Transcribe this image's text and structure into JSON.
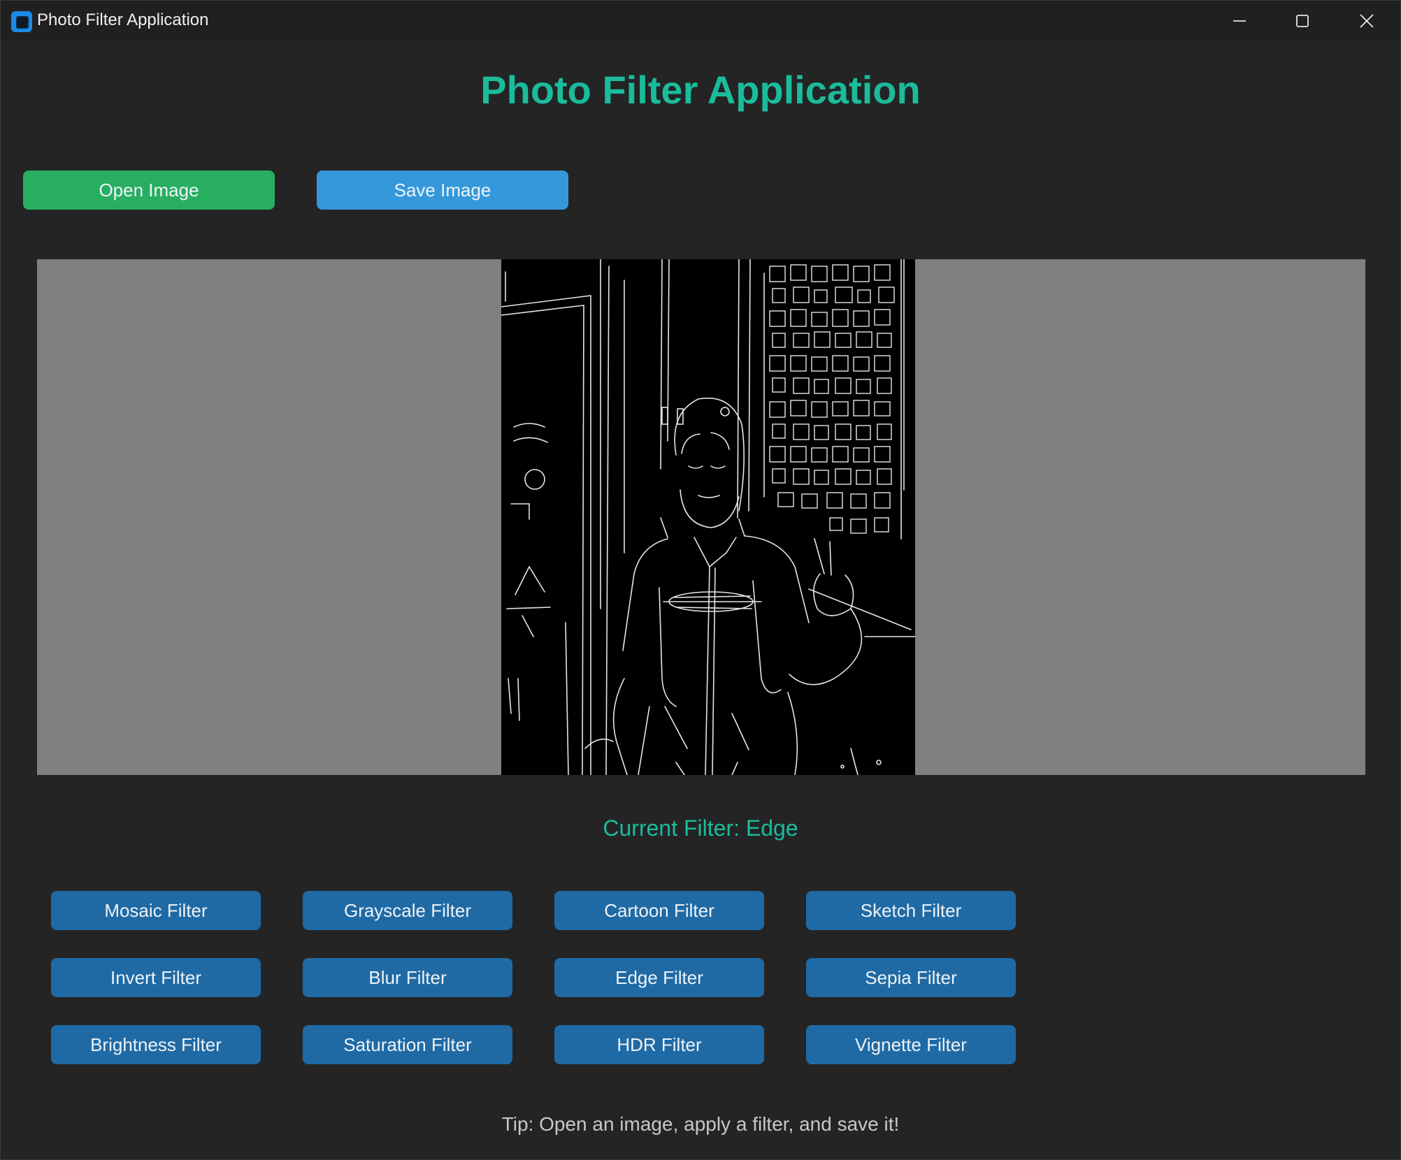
{
  "window": {
    "title": "Photo Filter Application",
    "controls": [
      "minimize-icon",
      "maximize-icon",
      "close-icon"
    ]
  },
  "header": {
    "title": "Photo Filter Application"
  },
  "toolbar": {
    "open_label": "Open Image",
    "save_label": "Save Image"
  },
  "preview": {
    "background": "#808080",
    "image": "edge-filtered photo: white outlines of a person making a peace sign in front of a lattice window and signage"
  },
  "status": {
    "text": "Current Filter: Edge"
  },
  "filters": [
    "Mosaic Filter",
    "Grayscale Filter",
    "Cartoon Filter",
    "Sketch Filter",
    "Invert Filter",
    "Blur Filter",
    "Edge Filter",
    "Sepia Filter",
    "Brightness Filter",
    "Saturation Filter",
    "HDR Filter",
    "Vignette Filter"
  ],
  "tip": {
    "text": "Tip: Open an image, apply a filter, and save it!"
  },
  "colors": {
    "accent": "#1abc9c",
    "open_button": "#27ae60",
    "save_button": "#3498db",
    "filter_button": "#1f6aa5",
    "background": "#242424"
  }
}
